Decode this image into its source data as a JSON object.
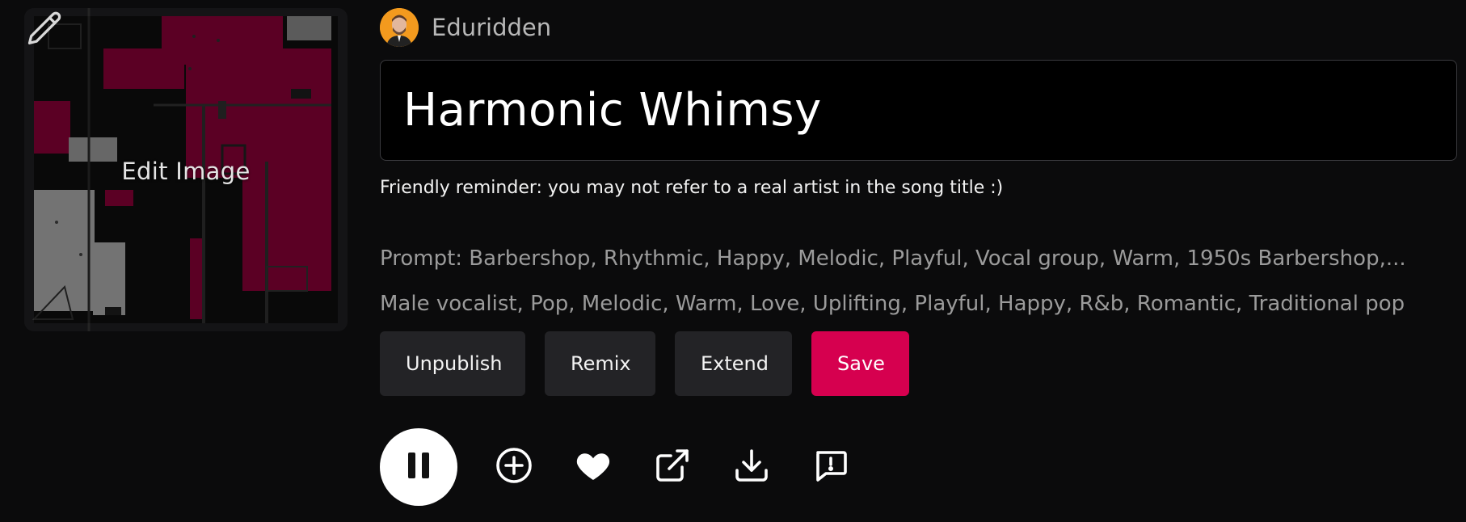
{
  "cover": {
    "edit_label": "Edit Image",
    "accent_color": "#7a0030"
  },
  "author": {
    "name": "Eduridden"
  },
  "song": {
    "title": "Harmonic Whimsy",
    "reminder": "Friendly reminder: you may not refer to a real artist in the song title :)",
    "prompt_line1": "Prompt: Barbershop, Rhythmic, Happy, Melodic, Playful, Vocal group, Warm, 1950s Barbershop,...",
    "prompt_line2": "Male vocalist, Pop, Melodic, Warm, Love, Uplifting, Playful, Happy, R&b, Romantic, Traditional pop"
  },
  "actions": {
    "unpublish": "Unpublish",
    "remix": "Remix",
    "extend": "Extend",
    "save": "Save",
    "save_color": "#d6004f"
  },
  "controls": {
    "play_state": "pause-icon",
    "icons": [
      "add-circle-icon",
      "heart-icon",
      "share-external-icon",
      "download-icon",
      "report-icon"
    ]
  }
}
